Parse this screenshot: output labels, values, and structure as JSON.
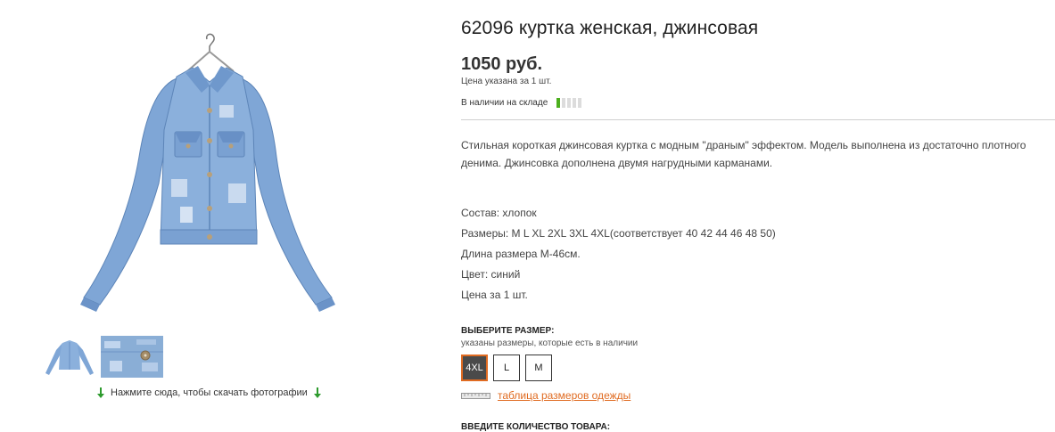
{
  "product": {
    "title": "62096 куртка женская, джинсовая",
    "price": "1050 руб.",
    "price_note": "Цена указана за 1 шт.",
    "stock_label": "В наличии на складе",
    "stock_level": 0.2,
    "description": "Стильная короткая джинсовая куртка с модным  \"драным\" эффектом. Модель выполнена из достаточно плотного денима. Джинсовка дополнена двумя нагрудными карманами.",
    "properties": [
      "Состав: хлопок",
      "Размеры:  M L XL 2XL 3XL 4XL(соответствует 40 42 44 46 48 50)",
      "Длина размера М-46см.",
      "Цвет: синий",
      "Цена за 1 шт."
    ]
  },
  "gallery": {
    "download_text": "Нажмите сюда, чтобы скачать фотографии",
    "icons": {
      "download": "arrow-down-icon"
    }
  },
  "size_selector": {
    "title": "ВЫБЕРИТЕ РАЗМЕР:",
    "note": "указаны размеры, которые есть в наличии",
    "options": [
      "4XL",
      "L",
      "M"
    ],
    "selected": "4XL",
    "size_table_link": "таблица размеров одежды"
  },
  "quantity": {
    "title": "ВВЕДИТЕ КОЛИЧЕСТВО ТОВАРА:"
  },
  "colors": {
    "accent": "#e06b21",
    "stock_green": "#4caf1e",
    "denim": "#7fa6d6"
  }
}
